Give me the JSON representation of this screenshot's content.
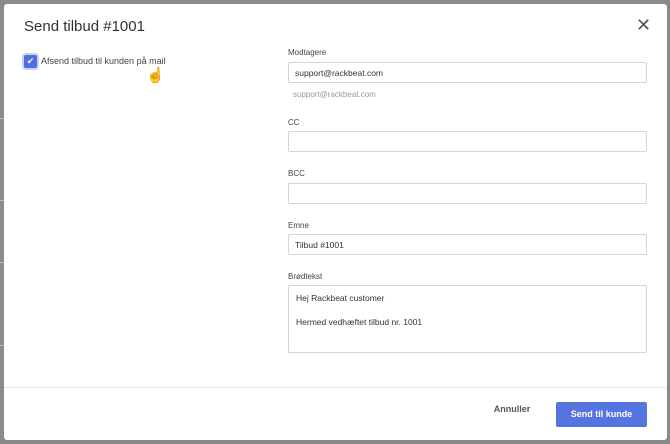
{
  "dialog": {
    "title": "Send tilbud #1001",
    "send_by_mail_label": "Afsend tilbud til kunden på mail",
    "send_by_mail_checked": true,
    "recipients_label": "Modtagere",
    "recipients_value": "support@rackbeat.com",
    "recipients_hint": "support@rackbeat.com",
    "cc_label": "CC",
    "cc_value": "",
    "bcc_label": "BCC",
    "bcc_value": "",
    "subject_label": "Emne",
    "subject_value": "Tilbud #1001",
    "body_label": "Brødtekst",
    "body_lines": [
      "Hej Rackbeat customer",
      "Hermed vedhæftet tilbud nr. 1001"
    ],
    "cancel_label": "Annuller",
    "send_label": "Send til kunde"
  },
  "colors": {
    "accent": "#5574e0"
  }
}
